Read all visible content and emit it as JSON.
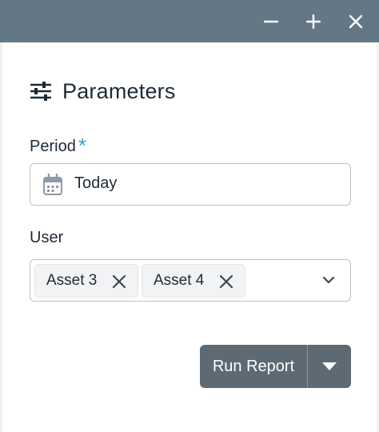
{
  "window": {
    "controls": [
      "minimize-icon",
      "maximize-icon",
      "close-icon"
    ],
    "titlebar_color": "#637785"
  },
  "panel": {
    "icon": "sliders-icon",
    "title": "Parameters"
  },
  "period": {
    "label": "Period",
    "required_marker": "*",
    "icon": "calendar-icon",
    "value": "Today"
  },
  "user": {
    "label": "User",
    "chips": [
      {
        "label": "Asset 3",
        "remove_icon": "close-icon"
      },
      {
        "label": "Asset 4",
        "remove_icon": "close-icon"
      }
    ],
    "dropdown_icon": "chevron-down-icon"
  },
  "actions": {
    "run_label": "Run Report",
    "toggle_icon": "caret-down-icon",
    "button_color": "#5e6a73",
    "accent_color": "#3aa0d0"
  }
}
